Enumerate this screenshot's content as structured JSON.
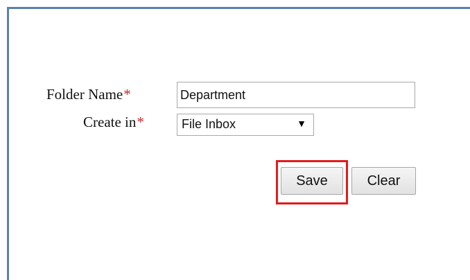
{
  "form": {
    "folder_name_label": "Folder Name",
    "create_in_label": "Create in",
    "required_marker": "*",
    "folder_name_value": "Department",
    "create_in_selected": "File Inbox",
    "save_label": "Save",
    "clear_label": "Clear"
  },
  "colors": {
    "frame_border": "#5a82ad",
    "required_marker": "#c0282f",
    "highlight": "#e31b1b"
  },
  "icons": {
    "select_arrow": "dropdown-arrow-icon"
  }
}
